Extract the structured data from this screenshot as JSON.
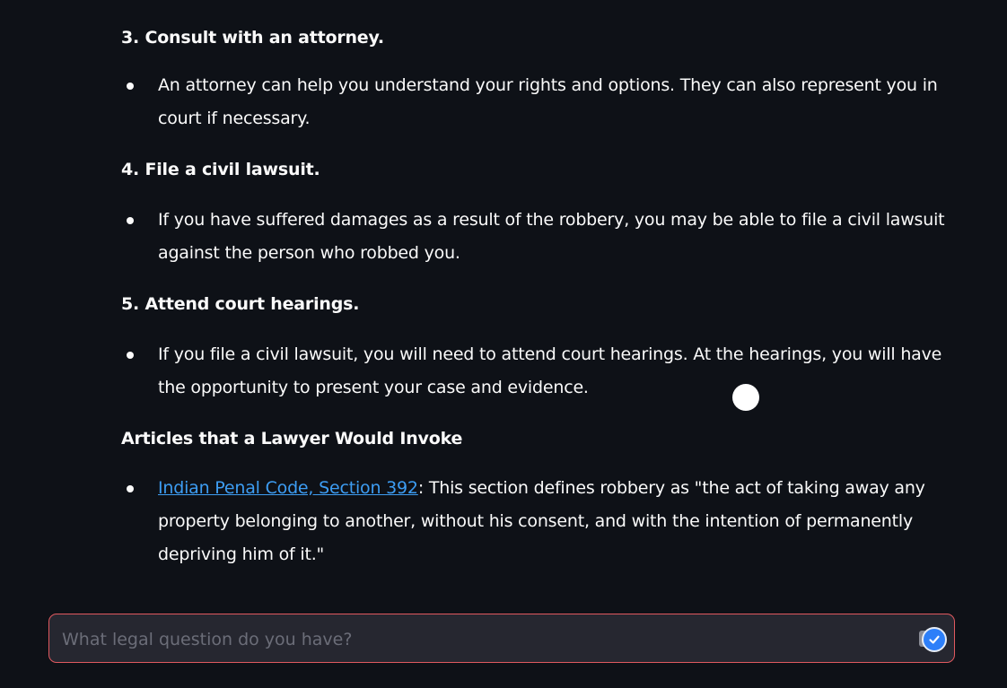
{
  "sections": [
    {
      "heading": "3. Consult with an attorney.",
      "bullets": [
        "An attorney can help you understand your rights and options. They can also represent you in court if necessary."
      ]
    },
    {
      "heading": "4. File a civil lawsuit.",
      "bullets": [
        "If you have suffered damages as a result of the robbery, you may be able to file a civil lawsuit against the person who robbed you."
      ]
    },
    {
      "heading": "5. Attend court hearings.",
      "bullets": [
        "If you file a civil lawsuit, you will need to attend court hearings. At the hearings, you will have the opportunity to present your case and evidence."
      ]
    }
  ],
  "articles": {
    "heading": "Articles that a Lawyer Would Invoke",
    "items": [
      {
        "link_text": "Indian Penal Code, Section 392",
        "text": ": This section defines robbery as \"the act of taking away any property belonging to another, without his consent, and with the intention of permanently depriving him of it.\""
      }
    ]
  },
  "chat_input": {
    "placeholder": "What legal question do you have?",
    "value": ""
  },
  "icons": {
    "submit": "check-icon"
  },
  "colors": {
    "background": "#0e1117",
    "link": "#3d9df3",
    "input_border": "#e0595f",
    "submit_button": "#2d7ff9"
  }
}
